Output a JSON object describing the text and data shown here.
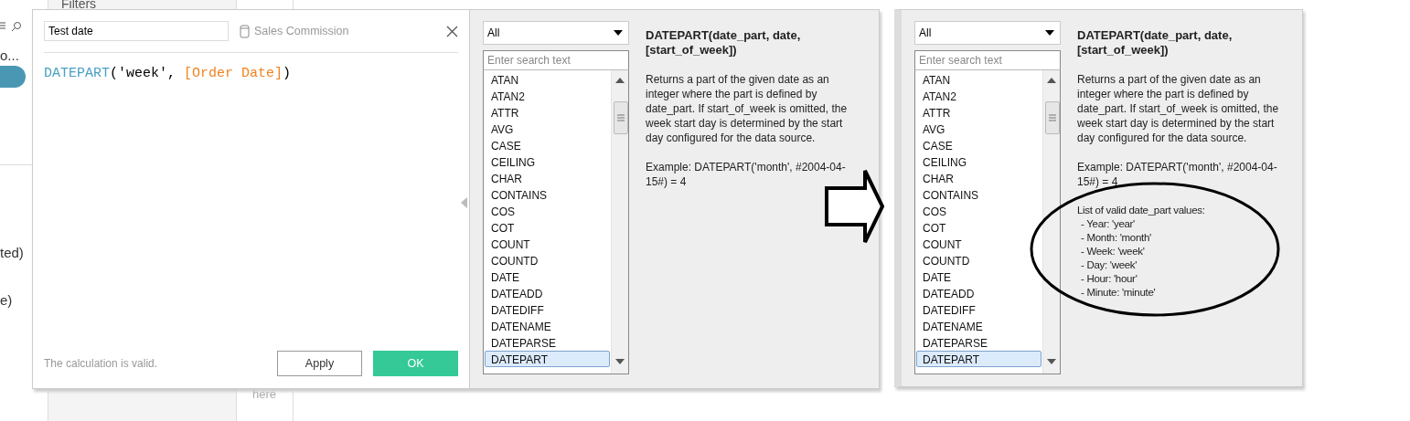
{
  "background": {
    "shelf_title": "Filters",
    "left_fragments": [
      "o...",
      "ted)",
      "e)"
    ],
    "drop_hint": "here"
  },
  "calc_editor": {
    "name": "Test date",
    "data_source": "Sales Commission",
    "formula": [
      {
        "kind": "function",
        "text": "DATEPART"
      },
      {
        "kind": "plain",
        "text": "('week', "
      },
      {
        "kind": "field",
        "text": "[Order Date]"
      },
      {
        "kind": "plain",
        "text": ")"
      }
    ],
    "status": "The calculation is valid.",
    "buttons": [
      {
        "label": "Apply",
        "kind": "secondary"
      },
      {
        "label": "OK",
        "kind": "primary"
      }
    ]
  },
  "function_panels": [
    {
      "category": "All",
      "search_placeholder": "Enter search text",
      "functions": [
        {
          "name": "ATAN",
          "selected": false
        },
        {
          "name": "ATAN2",
          "selected": false
        },
        {
          "name": "ATTR",
          "selected": false
        },
        {
          "name": "AVG",
          "selected": false
        },
        {
          "name": "CASE",
          "selected": false
        },
        {
          "name": "CEILING",
          "selected": false
        },
        {
          "name": "CHAR",
          "selected": false
        },
        {
          "name": "CONTAINS",
          "selected": false
        },
        {
          "name": "COS",
          "selected": false
        },
        {
          "name": "COT",
          "selected": false
        },
        {
          "name": "COUNT",
          "selected": false
        },
        {
          "name": "COUNTD",
          "selected": false
        },
        {
          "name": "DATE",
          "selected": false
        },
        {
          "name": "DATEADD",
          "selected": false
        },
        {
          "name": "DATEDIFF",
          "selected": false
        },
        {
          "name": "DATENAME",
          "selected": false
        },
        {
          "name": "DATEPARSE",
          "selected": false
        },
        {
          "name": "DATEPART",
          "selected": true
        }
      ],
      "help": {
        "signature": "DATEPART(date_part, date, [start_of_week])",
        "description": "Returns a part of the given date as an integer where the part is defined by date_part. If start_of_week is omitted, the week start day is determined by the start day configured for the data source.",
        "example": "Example: DATEPART('month', #2004-04-15#) = 4"
      }
    },
    {
      "category": "All",
      "search_placeholder": "Enter search text",
      "circled": true,
      "functions": [
        {
          "name": "ATAN",
          "selected": false
        },
        {
          "name": "ATAN2",
          "selected": false
        },
        {
          "name": "ATTR",
          "selected": false
        },
        {
          "name": "AVG",
          "selected": false
        },
        {
          "name": "CASE",
          "selected": false
        },
        {
          "name": "CEILING",
          "selected": false
        },
        {
          "name": "CHAR",
          "selected": false
        },
        {
          "name": "CONTAINS",
          "selected": false
        },
        {
          "name": "COS",
          "selected": false
        },
        {
          "name": "COT",
          "selected": false
        },
        {
          "name": "COUNT",
          "selected": false
        },
        {
          "name": "COUNTD",
          "selected": false
        },
        {
          "name": "DATE",
          "selected": false
        },
        {
          "name": "DATEADD",
          "selected": false
        },
        {
          "name": "DATEDIFF",
          "selected": false
        },
        {
          "name": "DATENAME",
          "selected": false
        },
        {
          "name": "DATEPARSE",
          "selected": false
        },
        {
          "name": "DATEPART",
          "selected": true
        }
      ],
      "help": {
        "signature": "DATEPART(date_part, date, [start_of_week])",
        "description": "Returns a part of the given date as an integer where the part is defined by date_part. If start_of_week is omitted, the week start day is determined by the start day configured for the data source.",
        "example": "Example: DATEPART('month', #2004-04-15#) = 4",
        "values_title": "List of valid date_part values:",
        "values": [
          "- Year: 'year'",
          "- Month: 'month'",
          "- Week: 'week'",
          "- Day: 'week'",
          "- Hour: 'hour'",
          "- Minute: 'minute'"
        ]
      }
    }
  ]
}
